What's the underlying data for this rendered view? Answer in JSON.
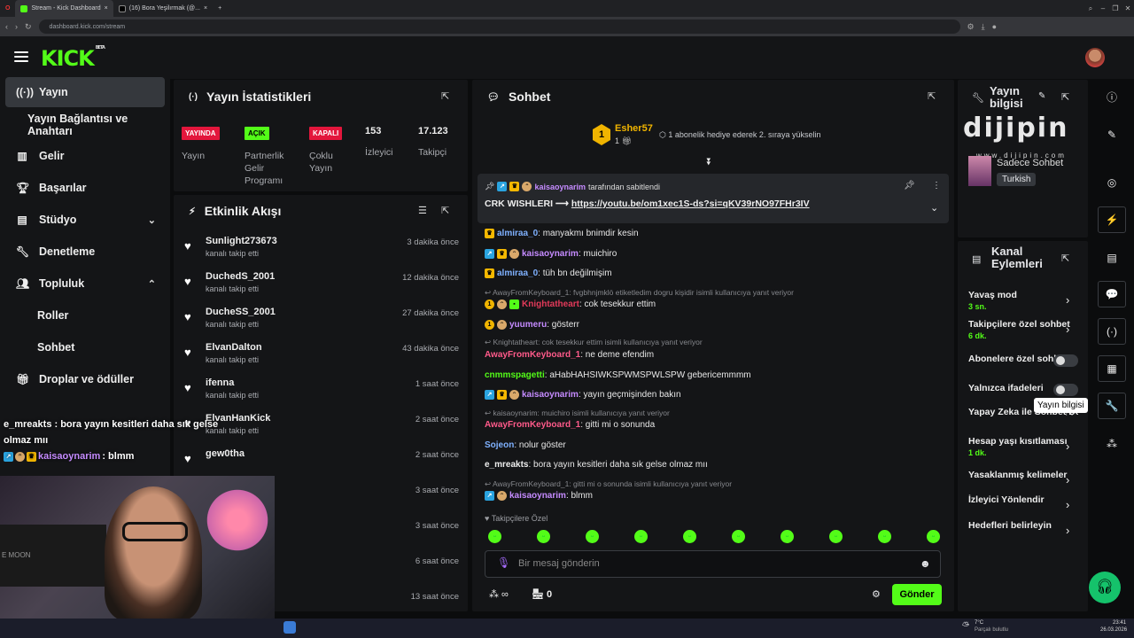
{
  "browser": {
    "tabs": [
      "Stream - Kick Dashboard",
      "(16) Bora Yeşilırmak (@..."
    ],
    "url": "dashboard.kick.com/stream"
  },
  "header": {
    "logo": "KICK",
    "beta": "BETA"
  },
  "sidebar": {
    "items": [
      {
        "label": "Yayın",
        "icon": "broadcast-icon"
      },
      {
        "label": "Yayın Bağlantısı ve Anahtarı"
      },
      {
        "label": "Gelir",
        "icon": "chart-icon"
      },
      {
        "label": "Başarılar",
        "icon": "trophy-icon"
      },
      {
        "label": "Stüdyo",
        "icon": "studio-icon"
      },
      {
        "label": "Denetleme",
        "icon": "wrench-icon"
      },
      {
        "label": "Topluluk",
        "icon": "people-icon"
      },
      {
        "label": "Roller"
      },
      {
        "label": "Sohbet"
      },
      {
        "label": "Droplar ve ödüller",
        "icon": "gift-icon"
      }
    ]
  },
  "stats": {
    "title": "Yayın İstatistikleri",
    "badges": [
      {
        "tag": "YAYINDA",
        "label": "Yayın",
        "color": "#e3163c"
      },
      {
        "tag": "AÇIK",
        "label": "Partnerlik Gelir Programı",
        "color": "#53fc18"
      },
      {
        "tag": "KAPALI",
        "label": "Çoklu Yayın",
        "color": "#e3163c"
      }
    ],
    "viewers": {
      "value": "153",
      "label": "İzleyici"
    },
    "followers": {
      "value": "17.123",
      "label": "Takipçi"
    }
  },
  "activity": {
    "title": "Etkinlik Akışı",
    "events": [
      {
        "name": "Sunlight273673",
        "sub": "kanalı takip etti",
        "time": "3 dakika önce"
      },
      {
        "name": "DuchedS_2001",
        "sub": "kanalı takip etti",
        "time": "12 dakika önce"
      },
      {
        "name": "DucheSS_2001",
        "sub": "kanalı takip etti",
        "time": "27 dakika önce"
      },
      {
        "name": "ElvanDalton",
        "sub": "kanalı takip etti",
        "time": "43 dakika önce"
      },
      {
        "name": "ifenna",
        "sub": "kanalı takip etti",
        "time": "1 saat önce"
      },
      {
        "name": "ElvanHanKick",
        "sub": "kanalı takip etti",
        "time": "2 saat önce"
      },
      {
        "name": "gew0tha",
        "sub": "",
        "time": "2 saat önce"
      },
      {
        "name": "",
        "sub": "",
        "time": "3 saat önce"
      },
      {
        "name": "",
        "sub": "",
        "time": "3 saat önce"
      },
      {
        "name": "",
        "sub": "",
        "time": "6 saat önce"
      },
      {
        "name": "",
        "sub": "",
        "time": "13 saat önce"
      }
    ]
  },
  "chat": {
    "title": "Sohbet",
    "leader": {
      "name": "Esher57",
      "count": "1",
      "note": "1 abonelik hediye ederek 2. sıraya yükselin"
    },
    "pinned": {
      "by": "kaisaoynarim",
      "by_suffix": "tarafından sabitlendi",
      "text": "CRK WISHLERI ⟶",
      "link": "https://youtu.be/om1xec1S-ds?si=qKV39rNO97FHr3IV"
    },
    "messages": [
      {
        "user": "almiraa_0",
        "color": "#7fb1ff",
        "text": ": manyakmı bnimdir kesin"
      },
      {
        "user": "kaisaoynarim",
        "color": "#c58bff",
        "text": ": muichiro"
      },
      {
        "user": "almiraa_0",
        "color": "#7fb1ff",
        "text": ": tüh bn değilmişim"
      },
      {
        "reply": "AwayFromKeyboard_1: fvgbhnjmklö etiketledim dogru kişidir isimli kullanıcıya yanıt veriyor"
      },
      {
        "user": "Knightatheart",
        "color": "#e33a5a",
        "text": ": cok tesekkur ettim"
      },
      {
        "user": "yuumeru",
        "color": "#c58bff",
        "text": ": gösterr"
      },
      {
        "reply": "Knightatheart: cok tesekkur ettim isimli kullanıcıya yanıt veriyor"
      },
      {
        "user": "AwayFromKeyboard_1",
        "color": "#ff5a8a",
        "text": ": ne deme efendim"
      },
      {
        "user": "cnmmspagetti",
        "color": "#53fc18",
        "text": ": aHabHAHSIWKSPWMSPWLSPW gebericemmmm"
      },
      {
        "user": "kaisaoynarim",
        "color": "#c58bff",
        "text": ": yayın geçmişinden bakın"
      },
      {
        "reply": "kaisaoynarim: muichiro isimli kullanıcıya yanıt veriyor"
      },
      {
        "user": "AwayFromKeyboard_1",
        "color": "#ff5a8a",
        "text": ": gitti mi o sonunda"
      },
      {
        "user": "Sojeon",
        "color": "#7fb1ff",
        "text": ": nolur göster"
      },
      {
        "user": "e_mreakts",
        "color": "#eee",
        "text": ": bora yayın kesitleri daha sık gelse olmaz mıı"
      },
      {
        "reply": "AwayFromKeyboard_1: gitti mi o sonunda isimli kullanıcıya yanıt veriyor"
      },
      {
        "user": "kaisaoynarim",
        "color": "#c58bff",
        "text": ": blmm"
      }
    ],
    "followers_only": "Takipçilere Özel",
    "placeholder": "Bir mesaj gönderin",
    "points": "0",
    "send": "Gönder"
  },
  "stream_info": {
    "title": "Yayın bilgisi",
    "category": "Sadece Sohbet",
    "tag": "Turkish",
    "tooltip": "Yayın bilgisi"
  },
  "channel_actions": {
    "title": "Kanal Eylemleri",
    "items": [
      {
        "label": "Yavaş mod",
        "sub": "3 sn."
      },
      {
        "label": "Takipçilere özel sohbet",
        "sub": "6 dk."
      },
      {
        "label": "Abonelere özel sohbet"
      },
      {
        "label": "Yalnızca ifadeleri"
      },
      {
        "label": "Yapay Zeka ile Sohbet Denetimi"
      },
      {
        "label": "Hesap yaşı kısıtlaması",
        "sub": "1 dk."
      },
      {
        "label": "Yasaklanmış kelimeler"
      },
      {
        "label": "İzleyici Yönlendir"
      },
      {
        "label": "Hedefleri belirleyin"
      }
    ]
  },
  "overlay": {
    "msg1_user": "e_mreakts",
    "msg1_text": " : bora yayın kesitleri daha sık gelse olmaz mıı",
    "msg2_user": "kaisaoynarim",
    "msg2_text": " : blmm",
    "watermark": "dijipin",
    "watermark_url": "www.dijipin.com",
    "cam_text": "E MOON"
  },
  "taskbar": {
    "weather": "7°C",
    "weather_sub": "Parçalı bulutlu",
    "time": "23:41",
    "date": "26.03.2026"
  }
}
